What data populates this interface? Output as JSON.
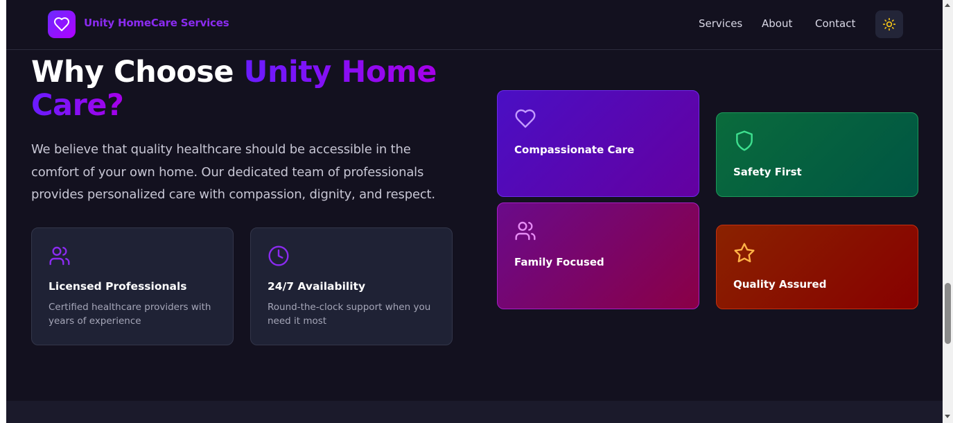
{
  "nav": {
    "brand": "Unity HomeCare Services",
    "links": [
      "Services",
      "About",
      "Contact"
    ],
    "theme_icon": "sun-icon"
  },
  "hero": {
    "title_plain": "Why Choose ",
    "title_accent_1": "Unity Home",
    "title_accent_2": "Care?",
    "lead": "We believe that quality healthcare should be accessible in the comfort of your own home. Our dedicated team of professionals provides personalized care with compassion, dignity, and respect."
  },
  "cards": [
    {
      "icon": "users-icon",
      "title": "Licensed Professionals",
      "desc": "Certified healthcare providers with years of experience"
    },
    {
      "icon": "clock-icon",
      "title": "24/7 Availability",
      "desc": "Round-the-clock support when you need it most"
    }
  ],
  "features": [
    {
      "icon": "heart-icon",
      "title": "Compassionate Care"
    },
    {
      "icon": "shield-icon",
      "title": "Safety First"
    },
    {
      "icon": "users-icon",
      "title": "Family Focused"
    },
    {
      "icon": "star-icon",
      "title": "Quality Assured"
    }
  ],
  "colors": {
    "background": "#13111f",
    "accent": "#8b2bf0",
    "safety": "#3ee08f",
    "family": "#e68cf5",
    "quality": "#ffb347"
  }
}
